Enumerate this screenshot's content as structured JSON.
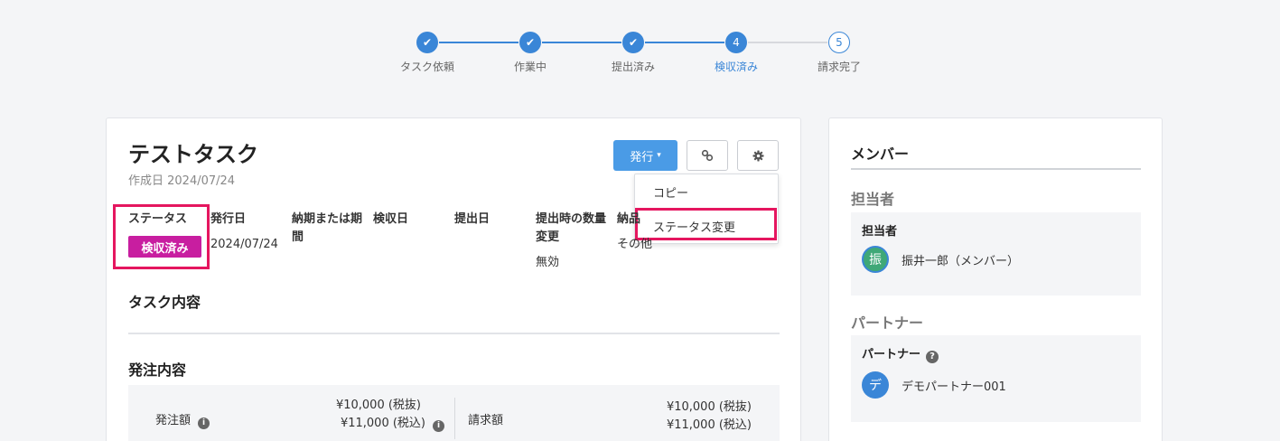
{
  "stepper": {
    "steps": [
      {
        "label": "タスク依頼",
        "state": "done",
        "symbol": "✔"
      },
      {
        "label": "作業中",
        "state": "done",
        "symbol": "✔"
      },
      {
        "label": "提出済み",
        "state": "done",
        "symbol": "✔"
      },
      {
        "label": "検収済み",
        "state": "current",
        "symbol": "4"
      },
      {
        "label": "請求完了",
        "state": "pending",
        "symbol": "5"
      }
    ]
  },
  "task": {
    "title": "テストタスク",
    "created": "作成日 2024/07/24"
  },
  "toolbar": {
    "issue_label": "発行",
    "issue_caret": "▾",
    "link_icon": "link-icon",
    "gear_icon": "gear-icon"
  },
  "dropdown": {
    "items": [
      "コピー",
      "ステータス変更"
    ]
  },
  "details": {
    "status_header": "ステータス",
    "status_value": "検収済み",
    "issue_date_header": "発行日",
    "issue_date_value": "2024/07/24",
    "deadline_header": "納期または期間",
    "inspection_header": "検収日",
    "submission_header": "提出日",
    "qty_change_header": "提出時の数量変更",
    "qty_change_value": "無効",
    "delivery_header": "納品",
    "delivery_value": "その他"
  },
  "sections": {
    "task_content": "タスク内容",
    "order_content": "発注内容"
  },
  "order": {
    "order_amount_label": "発注額",
    "order_amount_excl": "¥10,000 (税抜)",
    "order_amount_incl": "¥11,000 (税込)",
    "invoice_label": "請求額",
    "invoice_amount_excl": "¥10,000 (税抜)",
    "invoice_amount_incl": "¥11,000 (税込)"
  },
  "members": {
    "title": "メンバー",
    "assignee_section": "担当者",
    "assignee_box_title": "担当者",
    "assignee_avatar": "振",
    "assignee_name": "振井一郎（メンバー）",
    "partner_section": "パートナー",
    "partner_box_title": "パートナー",
    "partner_avatar": "デ",
    "partner_name": "デモパートナー001"
  },
  "colors": {
    "accent": "#3a86d7",
    "status_badge": "#c81ea0",
    "highlight": "#e5165f"
  }
}
